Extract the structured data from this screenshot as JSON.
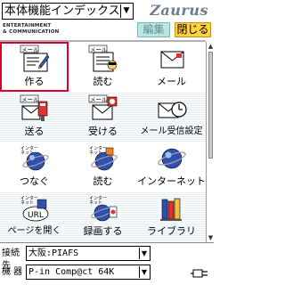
{
  "header": {
    "index_select": "本体機能インデックス",
    "brand": "Zaurus",
    "tagline_1": "ENTERTAINMENT",
    "tagline_2": "& COMMUNICATION",
    "edit_button": "編集",
    "close_button": "閉じる",
    "colors": {
      "edit_bg": "#b7e8e4",
      "close_bg": "#ffd040",
      "selected_border": "#e00030"
    }
  },
  "grid": {
    "rows": [
      [
        {
          "label": "作る",
          "icon": "mail-compose-icon",
          "badge": "メール",
          "selected": true
        },
        {
          "label": "読む",
          "icon": "mail-read-icon",
          "badge": "メール"
        },
        {
          "label": "メール",
          "icon": "mail-envelope-icon"
        }
      ],
      [
        {
          "label": "送る",
          "icon": "mail-send-icon",
          "badge": "メール"
        },
        {
          "label": "受ける",
          "icon": "mail-receive-icon",
          "badge": "メール"
        },
        {
          "label": "メール受信設定",
          "icon": "mail-receive-settings-icon"
        }
      ],
      [
        {
          "label": "つなぐ",
          "icon": "internet-connect-icon",
          "badge": "インターネット"
        },
        {
          "label": "読む",
          "icon": "internet-read-icon",
          "badge": "インターネット"
        },
        {
          "label": "インターネット",
          "icon": "internet-globe-icon"
        }
      ],
      [
        {
          "label": "ページを開く",
          "icon": "internet-open-url-icon",
          "badge": "インターネット"
        },
        {
          "label": "録画する",
          "icon": "internet-record-icon",
          "badge": "インターネット"
        },
        {
          "label": "ライブラリ",
          "icon": "library-books-icon"
        }
      ]
    ]
  },
  "footer": {
    "connection_label": "接続先",
    "connection_value": "大阪:PIAFS",
    "device_label": "機 器",
    "device_value": "P-in Comp@ct 64K"
  }
}
